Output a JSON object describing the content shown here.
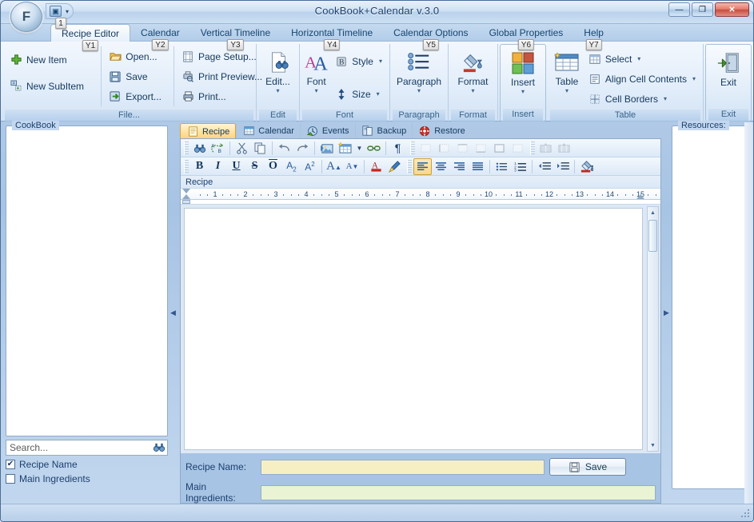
{
  "window": {
    "title": "CookBook+Calendar v.3.0",
    "orb_label": "F",
    "quick_access": {
      "badge": "1",
      "icon": "window-icon",
      "caret": "▾"
    },
    "buttons": {
      "minimize": "—",
      "maximize": "❐",
      "close": "✕"
    }
  },
  "ribbon_tabs": [
    {
      "label": "Recipe Editor",
      "keytip": "Y1",
      "active": true
    },
    {
      "label": "Calendar",
      "keytip": "Y2",
      "active": false
    },
    {
      "label": "Vertical Timeline",
      "keytip": "Y3",
      "active": false
    },
    {
      "label": "Horizontal Timeline",
      "keytip": "Y4",
      "active": false
    },
    {
      "label": "Calendar Options",
      "keytip": "Y5",
      "active": false
    },
    {
      "label": "Global Properties",
      "keytip": "Y6",
      "active": false
    },
    {
      "label": "Help",
      "keytip": "Y7",
      "active": false
    }
  ],
  "ribbon_groups": {
    "file": {
      "label": "File...",
      "new_item": "New Item",
      "new_subitem": "New SubItem",
      "open": "Open...",
      "save": "Save",
      "export": "Export...",
      "page_setup": "Page Setup...",
      "print_preview": "Print Preview...",
      "print": "Print..."
    },
    "edit": {
      "label": "Edit",
      "button": "Edit...",
      "caret": "▾"
    },
    "font": {
      "label": "Font",
      "font_button": "Font",
      "style": "Style",
      "size": "Size",
      "caret": "▾"
    },
    "paragraph": {
      "label": "Paragraph",
      "button": "Paragraph",
      "caret": "▾"
    },
    "format": {
      "label": "Format",
      "button": "Format",
      "caret": "▾"
    },
    "insert": {
      "label": "Insert",
      "button": "Insert",
      "caret": "▾"
    },
    "table": {
      "label": "Table",
      "button": "Table",
      "caret": "▾",
      "select": "Select",
      "align_cell_contents": "Align Cell Contents",
      "cell_borders": "Cell Borders"
    },
    "exit": {
      "label": "Exit",
      "button": "Exit"
    }
  },
  "sidebar": {
    "title": "CookBook",
    "search_placeholder": "Search...",
    "search_value": "",
    "search_icon": "binoculars-icon",
    "filters": [
      {
        "label": "Recipe Name",
        "checked": true,
        "mark": "✔"
      },
      {
        "label": "Main Ingredients",
        "checked": false,
        "mark": ""
      }
    ]
  },
  "resources": {
    "title": "Resources:"
  },
  "inner_tabs": [
    {
      "label": "Recipe",
      "icon": "document-icon",
      "active": true
    },
    {
      "label": "Calendar",
      "icon": "calendar-icon",
      "active": false
    },
    {
      "label": "Events",
      "icon": "events-icon",
      "active": false
    },
    {
      "label": "Backup",
      "icon": "backup-icon",
      "active": false
    },
    {
      "label": "Restore",
      "icon": "restore-icon",
      "active": false
    }
  ],
  "editor": {
    "doc_label": "Recipe",
    "content": "",
    "ruler_ticks": [
      "1",
      "2",
      "3",
      "4",
      "5",
      "6",
      "7",
      "8",
      "9",
      "10",
      "11",
      "12",
      "13",
      "14",
      "15"
    ],
    "toolbar_row1": [
      {
        "name": "find-icon",
        "glyph": "find",
        "disabled": false
      },
      {
        "name": "replace-icon",
        "glyph": "replace",
        "disabled": false
      },
      {
        "name": "cut-icon",
        "glyph": "✂",
        "disabled": false
      },
      {
        "name": "copy-icon",
        "glyph": "copy",
        "disabled": false
      },
      {
        "name": "undo-icon",
        "glyph": "↩",
        "disabled": false
      },
      {
        "name": "redo-icon",
        "glyph": "↪",
        "disabled": false
      },
      {
        "name": "insert-image-icon",
        "glyph": "image",
        "disabled": false
      },
      {
        "name": "insert-table-icon",
        "glyph": "table",
        "disabled": false
      },
      {
        "name": "insert-link-icon",
        "glyph": "link",
        "disabled": false
      },
      {
        "name": "show-formatting-marks-icon",
        "glyph": "¶",
        "disabled": false
      },
      {
        "name": "border-none-icon",
        "glyph": "border",
        "disabled": true
      },
      {
        "name": "border-left-icon",
        "glyph": "border",
        "disabled": true
      },
      {
        "name": "border-top-icon",
        "glyph": "border",
        "disabled": true
      },
      {
        "name": "border-bottom-icon",
        "glyph": "border",
        "disabled": true
      },
      {
        "name": "border-all-icon",
        "glyph": "border",
        "disabled": true
      },
      {
        "name": "border-inside-icon",
        "glyph": "border",
        "disabled": true
      },
      {
        "name": "merge-cells-icon",
        "glyph": "cells",
        "disabled": true
      },
      {
        "name": "split-cells-icon",
        "glyph": "cells",
        "disabled": true
      }
    ],
    "toolbar_row2": [
      {
        "name": "bold-icon",
        "glyph": "B",
        "style": "bold"
      },
      {
        "name": "italic-icon",
        "glyph": "I",
        "style": "italic"
      },
      {
        "name": "underline-icon",
        "glyph": "U",
        "style": "underline"
      },
      {
        "name": "strikethrough-icon",
        "glyph": "S",
        "style": "strike"
      },
      {
        "name": "overline-icon",
        "glyph": "O",
        "style": "overline"
      },
      {
        "name": "subscript-icon",
        "glyph": "A",
        "style": "sub"
      },
      {
        "name": "superscript-icon",
        "glyph": "A",
        "style": "sup"
      },
      {
        "name": "grow-font-icon",
        "glyph": "A",
        "style": "grow"
      },
      {
        "name": "shrink-font-icon",
        "glyph": "A",
        "style": "shrink"
      },
      {
        "name": "font-color-icon",
        "glyph": "A",
        "style": "fontcolor"
      },
      {
        "name": "highlight-icon",
        "glyph": "pencil",
        "style": "pencil"
      },
      {
        "name": "align-left-icon",
        "glyph": "lines",
        "style": "alignleft"
      },
      {
        "name": "align-center-icon",
        "glyph": "lines",
        "style": "aligncenter"
      },
      {
        "name": "align-right-icon",
        "glyph": "lines",
        "style": "alignright"
      },
      {
        "name": "justify-icon",
        "glyph": "lines",
        "style": "justify"
      },
      {
        "name": "bullet-list-icon",
        "glyph": "list",
        "style": "bullets"
      },
      {
        "name": "numbered-list-icon",
        "glyph": "list",
        "style": "numbers"
      },
      {
        "name": "decrease-indent-icon",
        "glyph": "indent",
        "style": "outdent"
      },
      {
        "name": "increase-indent-icon",
        "glyph": "indent",
        "style": "indent"
      },
      {
        "name": "background-color-icon",
        "glyph": "bucket",
        "style": "bucket"
      }
    ]
  },
  "form": {
    "recipe_name_label": "Recipe Name:",
    "recipe_name_value": "",
    "main_ingredients_label": "Main Ingredients:",
    "main_ingredients_value": "",
    "save_label": "Save",
    "save_icon": "floppy-icon"
  },
  "colors": {
    "accent": "#15428b",
    "active_tab": "#ffd280",
    "recipe_field": "#f7efc4",
    "ingredients_field": "#eaf4d4",
    "close_button": "#c94b3c"
  }
}
